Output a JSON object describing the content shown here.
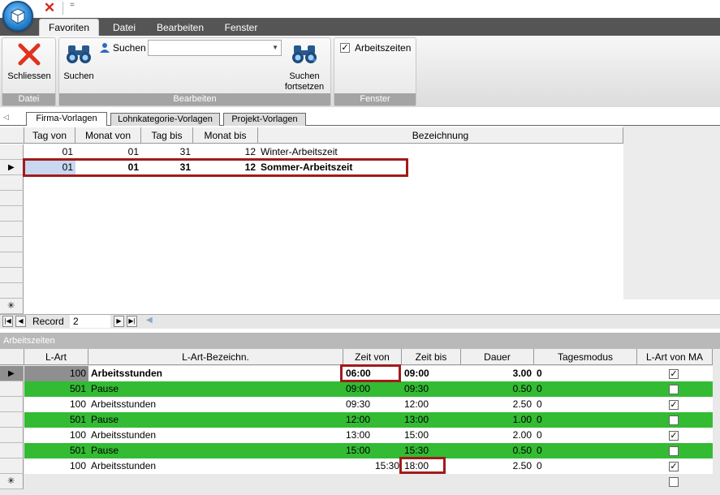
{
  "quick_access": {
    "close_glyph": "✕",
    "dropdown_glyph": "="
  },
  "menu": {
    "tabs": [
      "Favoriten",
      "Datei",
      "Bearbeiten",
      "Fenster"
    ]
  },
  "ribbon": {
    "close_label": "Schliessen",
    "search_label": "Suchen",
    "search_field_label": "Suchen",
    "search_field_value": "",
    "continue_label_1": "Suchen",
    "continue_label_2": "fortsetzen",
    "arbeitszeiten_label": "Arbeitszeiten",
    "arbeitszeiten_checked": true,
    "groups": [
      "Datei",
      "Bearbeiten",
      "Fenster"
    ]
  },
  "document_tabs": [
    "Firma-Vorlagen",
    "Lohnkategorie-Vorlagen",
    "Projekt-Vorlagen"
  ],
  "templates_grid": {
    "columns": [
      "Tag von",
      "Monat von",
      "Tag bis",
      "Monat bis",
      "Bezeichnung"
    ],
    "rows": [
      {
        "tag_von": "01",
        "monat_von": "01",
        "tag_bis": "31",
        "monat_bis": "12",
        "bezeichnung": "Winter-Arbeitszeit"
      },
      {
        "tag_von": "01",
        "monat_von": "01",
        "tag_bis": "31",
        "monat_bis": "12",
        "bezeichnung": "Sommer-Arbeitszeit"
      }
    ],
    "new_row_glyph": "✳"
  },
  "navigator": {
    "record_label": "Record",
    "record_value": "2"
  },
  "section_title": "Arbeitszeiten",
  "work_grid": {
    "columns": [
      "L-Art",
      "L-Art-Bezeichn.",
      "Zeit von",
      "Zeit bis",
      "Dauer",
      "Tagesmodus",
      "L-Art von MA"
    ],
    "rows": [
      {
        "lart": "100",
        "bez": "Arbeitsstunden",
        "von": "06:00",
        "bis": "09:00",
        "dauer": "3.00",
        "modus": "0",
        "ma": true
      },
      {
        "lart": "501",
        "bez": "Pause",
        "von": "09:00",
        "bis": "09:30",
        "dauer": "0.50",
        "modus": "0",
        "ma": false
      },
      {
        "lart": "100",
        "bez": "Arbeitsstunden",
        "von": "09:30",
        "bis": "12:00",
        "dauer": "2.50",
        "modus": "0",
        "ma": true
      },
      {
        "lart": "501",
        "bez": "Pause",
        "von": "12:00",
        "bis": "13:00",
        "dauer": "1.00",
        "modus": "0",
        "ma": false
      },
      {
        "lart": "100",
        "bez": "Arbeitsstunden",
        "von": "13:00",
        "bis": "15:00",
        "dauer": "2.00",
        "modus": "0",
        "ma": true
      },
      {
        "lart": "501",
        "bez": "Pause",
        "von": "15:00",
        "bis": "15:30",
        "dauer": "0.50",
        "modus": "0",
        "ma": false
      },
      {
        "lart": "100",
        "bez": "Arbeitsstunden",
        "von": "15:30",
        "bis": "18:00",
        "dauer": "2.50",
        "modus": "0",
        "ma": true
      }
    ]
  },
  "colors": {
    "pause_row": "#33bb33",
    "highlight_box": "#a11b1b",
    "menubar": "#555555"
  }
}
